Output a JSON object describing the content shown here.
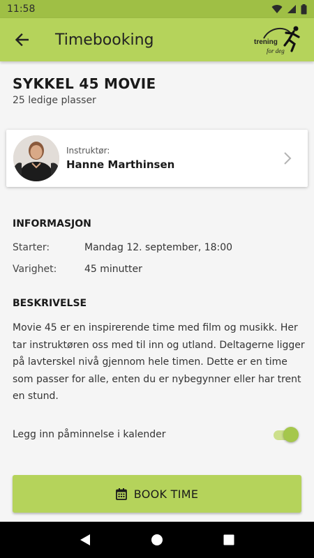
{
  "status_bar": {
    "time": "11:58"
  },
  "app_bar": {
    "title": "Timebooking",
    "logo_line1": "trening",
    "logo_line2": "for deg"
  },
  "class": {
    "title": "SYKKEL 45 MOVIE",
    "spots": "25 ledige plasser"
  },
  "instructor": {
    "label": "Instruktør:",
    "name": "Hanne Marthinsen"
  },
  "info": {
    "heading": "INFORMASJON",
    "rows": [
      {
        "label": "Starter:",
        "value": "Mandag 12. september, 18:00"
      },
      {
        "label": "Varighet:",
        "value": "45 minutter"
      }
    ]
  },
  "description": {
    "heading": "BESKRIVELSE",
    "text": "Movie 45 er en inspirerende time med film og musikk. Her tar instruktøren oss med til inn og utland. Deltagerne ligger på lavterskel nivå gjennom hele timen. Dette er en time som passer for alle, enten du er nybegynner eller har trent en stund."
  },
  "reminder": {
    "label": "Legg inn påminnelse i kalender",
    "enabled": true
  },
  "book_button": {
    "label": "BOOK TIME"
  },
  "colors": {
    "accent": "#b5d35b",
    "status_bar": "#9fbf45",
    "toggle": "#a5c74c"
  }
}
